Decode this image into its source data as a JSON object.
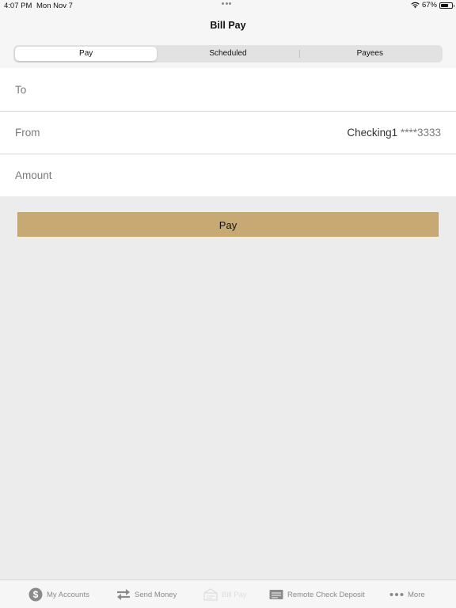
{
  "status_bar": {
    "time": "4:07 PM",
    "date": "Mon Nov 7",
    "battery_text": "67%",
    "battery_level": 0.67
  },
  "nav": {
    "title": "Bill Pay"
  },
  "segments": [
    {
      "label": "Pay",
      "active": true
    },
    {
      "label": "Scheduled",
      "active": false
    },
    {
      "label": "Payees",
      "active": false
    }
  ],
  "form": {
    "to_label": "To",
    "to_value": "",
    "from_label": "From",
    "from_account_name": "Checking1",
    "from_account_mask": "****3333",
    "amount_label": "Amount",
    "amount_value": ""
  },
  "pay_button": {
    "label": "Pay"
  },
  "tab_bar": {
    "items": [
      {
        "label": "My Accounts",
        "icon": "dollar-circle-icon",
        "enabled": true
      },
      {
        "label": "Send Money",
        "icon": "transfer-arrows-icon",
        "enabled": true
      },
      {
        "label": "Bill Pay",
        "icon": "bill-pay-icon",
        "enabled": false,
        "selected": true
      },
      {
        "label": "Remote Check Deposit",
        "icon": "check-icon",
        "enabled": true
      },
      {
        "label": "More",
        "icon": "more-dots-icon",
        "enabled": true
      }
    ]
  },
  "colors": {
    "accent": "#c7aa73",
    "background": "#ececec",
    "surface": "#ffffff",
    "muted_text": "#7a7a7a",
    "tab_text": "#8a8a8a"
  }
}
